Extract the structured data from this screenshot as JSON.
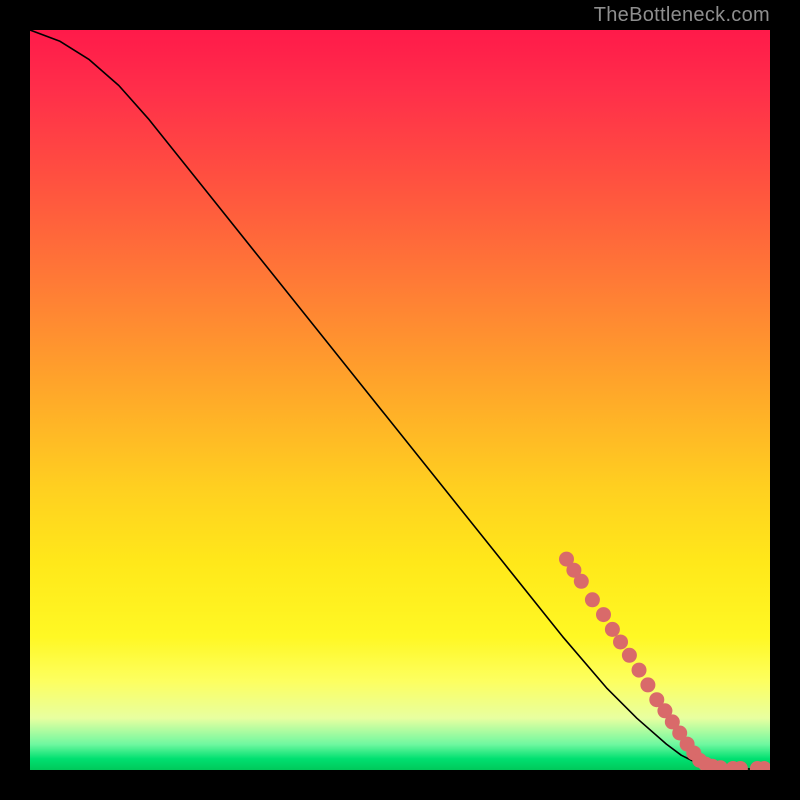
{
  "watermark": "TheBottleneck.com",
  "chart_data": {
    "type": "line",
    "title": "",
    "xlabel": "",
    "ylabel": "",
    "xlim": [
      0,
      100
    ],
    "ylim": [
      0,
      100
    ],
    "grid": false,
    "series": [
      {
        "name": "curve",
        "x": [
          0,
          4,
          8,
          12,
          16,
          24,
          32,
          40,
          48,
          56,
          64,
          72,
          78,
          82,
          86,
          88,
          90,
          92,
          94,
          96,
          98,
          100
        ],
        "y": [
          100,
          98.5,
          96,
          92.5,
          88,
          78,
          68,
          58,
          48,
          38,
          28,
          18,
          11,
          7,
          3.5,
          2,
          1,
          0.5,
          0.3,
          0.2,
          0.1,
          0.1
        ]
      }
    ],
    "points": [
      {
        "x": 72.5,
        "y": 28.5
      },
      {
        "x": 73.5,
        "y": 27.0
      },
      {
        "x": 74.5,
        "y": 25.5
      },
      {
        "x": 76.0,
        "y": 23.0
      },
      {
        "x": 77.5,
        "y": 21.0
      },
      {
        "x": 78.7,
        "y": 19.0
      },
      {
        "x": 79.8,
        "y": 17.3
      },
      {
        "x": 81.0,
        "y": 15.5
      },
      {
        "x": 82.3,
        "y": 13.5
      },
      {
        "x": 83.5,
        "y": 11.5
      },
      {
        "x": 84.7,
        "y": 9.5
      },
      {
        "x": 85.8,
        "y": 8.0
      },
      {
        "x": 86.8,
        "y": 6.5
      },
      {
        "x": 87.8,
        "y": 5.0
      },
      {
        "x": 88.8,
        "y": 3.5
      },
      {
        "x": 89.7,
        "y": 2.3
      },
      {
        "x": 90.5,
        "y": 1.3
      },
      {
        "x": 91.3,
        "y": 0.8
      },
      {
        "x": 92.2,
        "y": 0.5
      },
      {
        "x": 93.3,
        "y": 0.3
      },
      {
        "x": 95.0,
        "y": 0.2
      },
      {
        "x": 96.0,
        "y": 0.2
      },
      {
        "x": 98.3,
        "y": 0.2
      },
      {
        "x": 99.2,
        "y": 0.2
      }
    ],
    "annotations": []
  }
}
